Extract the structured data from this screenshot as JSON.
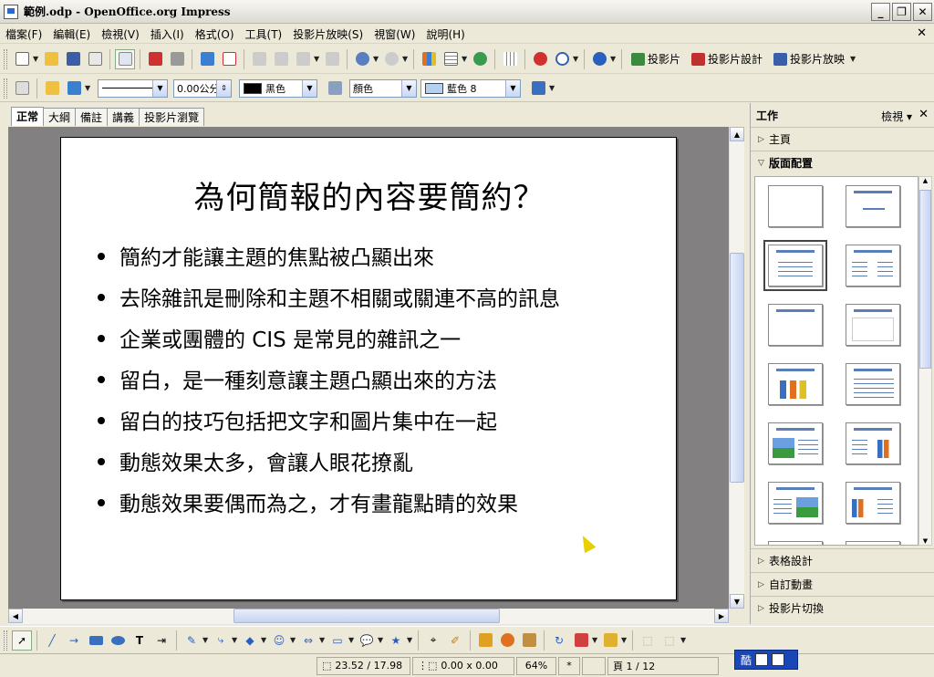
{
  "window": {
    "title": "範例.odp - OpenOffice.org Impress"
  },
  "menu": [
    "檔案(F)",
    "編輯(E)",
    "檢視(V)",
    "插入(I)",
    "格式(O)",
    "工具(T)",
    "投影片放映(S)",
    "視窗(W)",
    "說明(H)"
  ],
  "toolbar1": {
    "slide_label": "投影片",
    "slide_design_label": "投影片設計",
    "slideshow_label": "投影片放映"
  },
  "toolbar2": {
    "line_width": "0.00公分",
    "line_color": "黑色",
    "line_color_hex": "#000000",
    "area_style": "顏色",
    "area_color": "藍色 8",
    "area_color_hex": "#b5d0f0"
  },
  "view_tabs": [
    "正常",
    "大綱",
    "備註",
    "講義",
    "投影片瀏覽"
  ],
  "slide": {
    "title": "為何簡報的內容要簡約？",
    "bullets": [
      "簡約才能讓主題的焦點被凸顯出來",
      "去除雜訊是刪除和主題不相關或關連不高的訊息",
      "企業或團體的 CIS 是常見的雜訊之一",
      "留白，是一種刻意讓主題凸顯出來的方法",
      "留白的技巧包括把文字和圖片集中在一起",
      "動態效果太多，會讓人眼花撩亂",
      "動態效果要偶而為之，才有畫龍點睛的效果"
    ]
  },
  "task_pane": {
    "title": "工作",
    "view_label": "檢視",
    "sections_top": [
      "主頁",
      "版面配置"
    ],
    "sections_bottom": [
      "表格設計",
      "自訂動畫",
      "投影片切換"
    ]
  },
  "status": {
    "position": "23.52 / 17.98",
    "size": "0.00 x 0.00",
    "zoom": "64%",
    "modified": "*",
    "page": "頁 1 / 12"
  },
  "ime": {
    "label": "酷"
  }
}
